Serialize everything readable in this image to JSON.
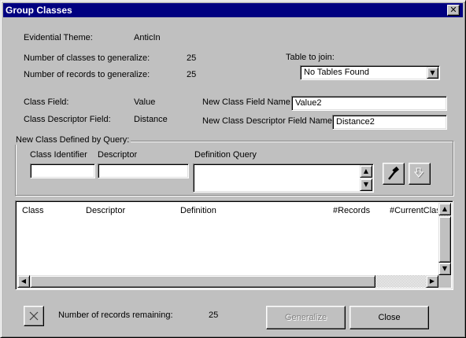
{
  "window": {
    "title": "Group Classes",
    "close_glyph": "✕"
  },
  "info": {
    "evidential_theme_label": "Evidential Theme:",
    "evidential_theme_value": "AnticIn",
    "num_classes_label": "Number of classes to generalize:",
    "num_classes_value": "25",
    "num_records_label": "Number of records to generalize:",
    "num_records_value": "25",
    "class_field_label": "Class Field:",
    "class_field_value": "Value",
    "class_desc_field_label": "Class Descriptor Field:",
    "class_desc_field_value": "Distance"
  },
  "table_join": {
    "label": "Table to join:",
    "selected": "No Tables Found"
  },
  "new_fields": {
    "class_field_name_label": "New Class Field Name:",
    "class_field_name_value": "Value2",
    "desc_field_name_label": "New Class Descriptor Field Name:",
    "desc_field_name_value": "Distance2"
  },
  "query_group": {
    "title": "New Class Defined by Query:",
    "class_identifier_label": "Class Identifier",
    "class_identifier_value": "",
    "descriptor_label": "Descriptor",
    "descriptor_value": "",
    "definition_query_label": "Definition Query",
    "definition_query_value": ""
  },
  "table": {
    "columns": [
      "Class",
      "Descriptor",
      "Definition",
      "#Records",
      "#CurrentClass"
    ],
    "rows": []
  },
  "footer": {
    "remaining_label": "Number of records remaining:",
    "remaining_value": "25",
    "generalize_label": "Generalize",
    "close_label": "Close"
  },
  "icons": {
    "delete": "delete-x-icon",
    "add_query": "hammer-icon",
    "apply_query": "query-arrow-icon"
  }
}
